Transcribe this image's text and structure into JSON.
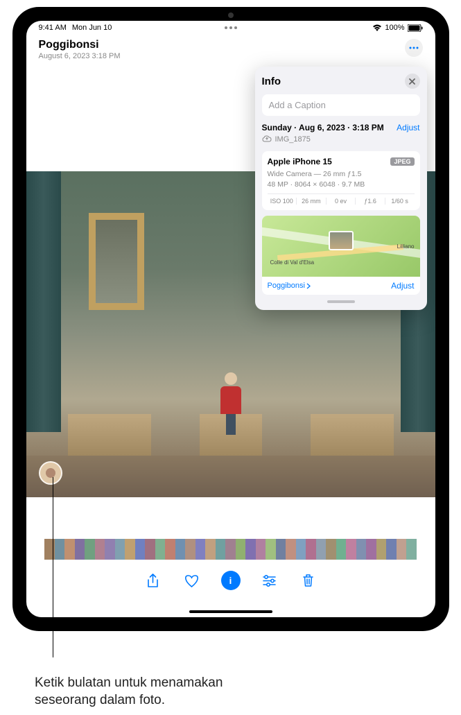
{
  "status_bar": {
    "time": "9:41 AM",
    "date": "Mon Jun 10",
    "battery_pct": "100%"
  },
  "header": {
    "location": "Poggibonsi",
    "date_line": "August 6, 2023   3:18 PM"
  },
  "info_panel": {
    "title": "Info",
    "caption_placeholder": "Add a Caption",
    "date_line": "Sunday · Aug 6, 2023 · 3:18 PM",
    "adjust": "Adjust",
    "filename": "IMG_1875",
    "device": "Apple iPhone 15",
    "format": "JPEG",
    "camera_line": "Wide Camera — 26 mm ƒ1.5",
    "specs_line": "48 MP · 8064 × 6048 · 9.7 MB",
    "tech": {
      "iso": "ISO 100",
      "focal": "26 mm",
      "ev": "0 ev",
      "aperture": "ƒ1.6",
      "shutter": "1/60 s"
    },
    "map": {
      "label_colle": "Colle di Val d'Elsa",
      "label_lilliano": "Lilliano",
      "location_link": "Poggibonsi",
      "adjust": "Adjust"
    }
  },
  "thumb_colors": [
    "#a08060",
    "#7090a0",
    "#c09070",
    "#8070a0",
    "#70a080",
    "#b08090",
    "#9080b0",
    "#80a0b0",
    "#c0a070",
    "#7080c0",
    "#a07080",
    "#80b090",
    "#c08070",
    "#7090b0",
    "#b09080",
    "#8080c0",
    "#c0a080",
    "#70a0a0",
    "#a08090",
    "#90b070",
    "#8070b0",
    "#b080a0",
    "#a0c080",
    "#7080a0",
    "#c09080",
    "#80a0c0",
    "#b07090",
    "#90a0b0",
    "#a09070",
    "#70b090",
    "#c080a0",
    "#8090b0",
    "#a070a0",
    "#b0a070",
    "#7080b0",
    "#c0a090",
    "#80b0a0"
  ],
  "callout": {
    "line1": "Ketik bulatan untuk menamakan",
    "line2": "seseorang dalam foto."
  }
}
